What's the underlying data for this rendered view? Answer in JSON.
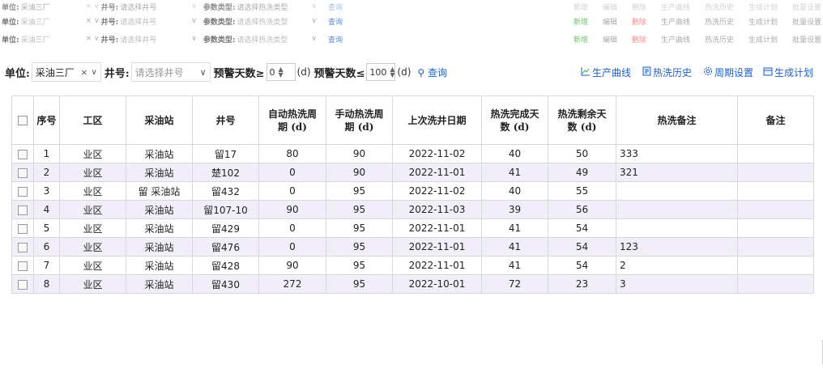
{
  "ghost_bar": {
    "unit_label": "单位:",
    "unit_value": "采油三厂",
    "well_label": "井号:",
    "well_placeholder": "请选择井号",
    "param_label": "参数类型:",
    "param_placeholder": "请选择热洗类型",
    "query": "查询",
    "actions": [
      "新增",
      "编辑",
      "删除",
      "生产曲线",
      "热洗历史",
      "生成计划",
      "批量设置"
    ]
  },
  "toolbar": {
    "unit_label": "单位:",
    "unit_value": "采油三厂",
    "well_label": "井号:",
    "well_placeholder": "请选择井号",
    "warn_days_ge_label": "预警天数≥",
    "warn_days_ge_value": "0",
    "unit_d1": "(d)",
    "warn_days_le_label": "预警天数≤",
    "warn_days_le_value": "100",
    "unit_d2": "(d)",
    "query_label": "查询",
    "buttons": {
      "production_curve": "生产曲线",
      "wash_history": "热洗历史",
      "period_settings": "周期设置",
      "generate_plan": "生成计划"
    }
  },
  "table": {
    "headers": {
      "index": "序号",
      "area": "工区",
      "station": "采油站",
      "well": "井号",
      "auto_period": "自动热洗周期 (d)",
      "manual_period": "手动热洗周期 (d)",
      "last_wash": "上次洗井日期",
      "done_days": "热洗完成天数 (d)",
      "remain_days": "热洗剩余天数 (d)",
      "wash_note": "热洗备注",
      "note": "备注"
    },
    "rows": [
      {
        "index": "1",
        "area": "业区",
        "station": "采油站",
        "well": "留17",
        "auto": "80",
        "manual": "90",
        "last": "2022-11-02",
        "done": "40",
        "remain": "50",
        "wash_note": "333",
        "note": ""
      },
      {
        "index": "2",
        "area": "业区",
        "station": "采油站",
        "well": "楚102",
        "auto": "0",
        "manual": "90",
        "last": "2022-11-01",
        "done": "41",
        "remain": "49",
        "wash_note": "321",
        "note": ""
      },
      {
        "index": "3",
        "area": "业区",
        "station": "留 采油站",
        "well": "留432",
        "auto": "0",
        "manual": "95",
        "last": "2022-11-02",
        "done": "40",
        "remain": "55",
        "wash_note": "",
        "note": ""
      },
      {
        "index": "4",
        "area": "业区",
        "station": "采油站",
        "well": "留107-10",
        "auto": "90",
        "manual": "95",
        "last": "2022-11-03",
        "done": "39",
        "remain": "56",
        "wash_note": "",
        "note": ""
      },
      {
        "index": "5",
        "area": "业区",
        "station": "采油站",
        "well": "留429",
        "auto": "0",
        "manual": "95",
        "last": "2022-11-01",
        "done": "41",
        "remain": "54",
        "wash_note": "",
        "note": ""
      },
      {
        "index": "6",
        "area": "业区",
        "station": "采油站",
        "well": "留476",
        "auto": "0",
        "manual": "95",
        "last": "2022-11-01",
        "done": "41",
        "remain": "54",
        "wash_note": "123",
        "note": ""
      },
      {
        "index": "7",
        "area": "业区",
        "station": "采油站",
        "well": "留428",
        "auto": "90",
        "manual": "95",
        "last": "2022-11-01",
        "done": "41",
        "remain": "54",
        "wash_note": "2",
        "note": ""
      },
      {
        "index": "8",
        "area": "业区",
        "station": "采油站",
        "well": "留430",
        "auto": "272",
        "manual": "95",
        "last": "2022-10-01",
        "done": "72",
        "remain": "23",
        "wash_note": "3",
        "note": ""
      }
    ]
  },
  "icons": {
    "add": "plus-circle-icon",
    "edit": "pencil-icon",
    "delete": "x-icon",
    "curve": "chart-icon",
    "history": "document-icon",
    "settings": "gear-icon",
    "plan": "calendar-icon",
    "batch": "stack-icon",
    "search": "search-icon"
  },
  "colors": {
    "accent": "#1e60c8",
    "row_alt": "#f1eef9",
    "add_green": "#3aaa35",
    "delete_red": "#e53935"
  }
}
